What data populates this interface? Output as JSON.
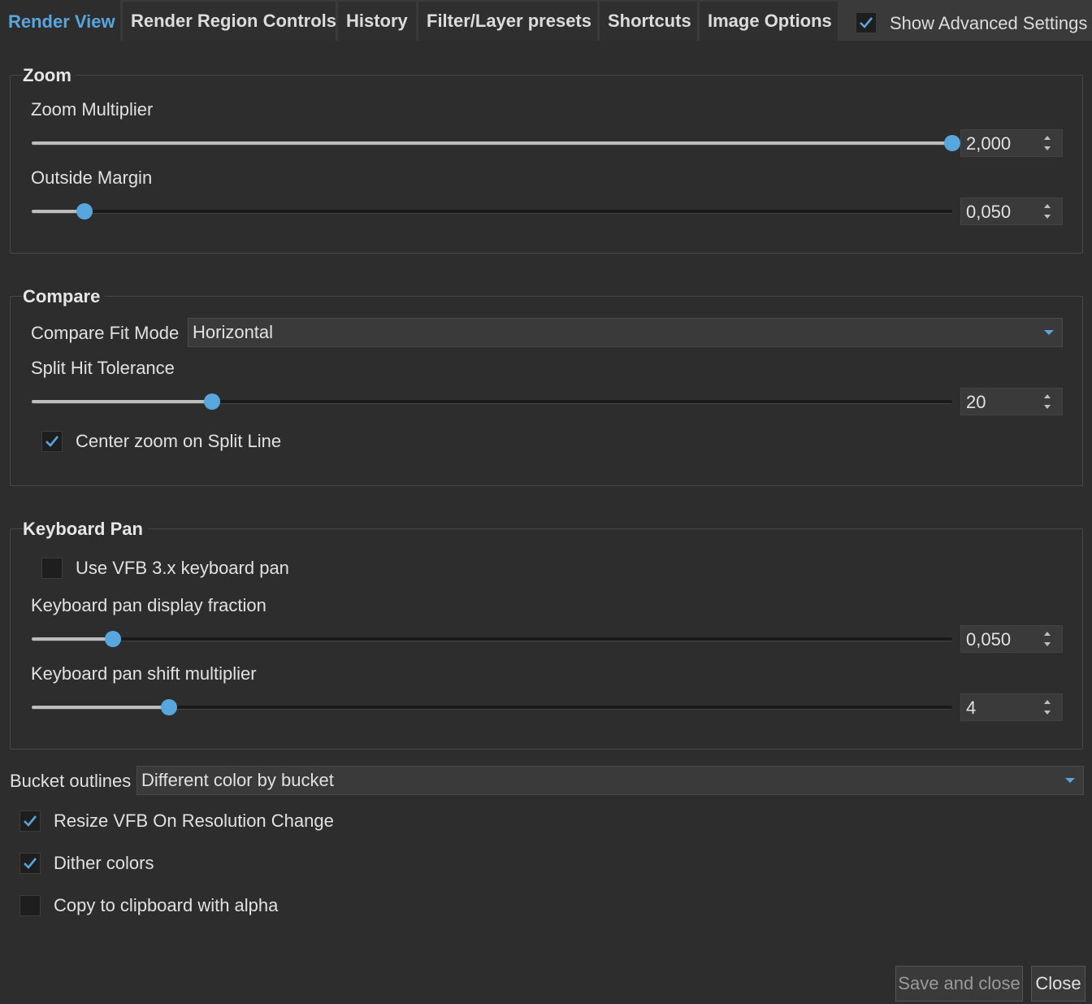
{
  "tabs": [
    {
      "label": "Render View",
      "active": true
    },
    {
      "label": "Render Region Controls"
    },
    {
      "label": "History"
    },
    {
      "label": "Filter/Layer presets"
    },
    {
      "label": "Shortcuts"
    },
    {
      "label": "Image Options"
    }
  ],
  "show_advanced": {
    "label": "Show Advanced Settings",
    "checked": true
  },
  "zoom": {
    "title": "Zoom",
    "multiplier": {
      "label": "Zoom Multiplier",
      "value": "2,000",
      "fraction": 1.0
    },
    "margin": {
      "label": "Outside Margin",
      "value": "0,050",
      "fraction": 0.057
    }
  },
  "compare": {
    "title": "Compare",
    "fit_mode_label": "Compare Fit Mode",
    "fit_mode_value": "Horizontal",
    "split": {
      "label": "Split Hit Tolerance",
      "value": "20",
      "fraction": 0.196
    },
    "center_zoom": {
      "label": "Center zoom on Split Line",
      "checked": true
    }
  },
  "keyboard_pan": {
    "title": "Keyboard Pan",
    "use_vfb3": {
      "label": "Use VFB 3.x keyboard pan",
      "checked": false
    },
    "fraction": {
      "label": "Keyboard pan display fraction",
      "value": "0,050",
      "fraction": 0.088
    },
    "shift": {
      "label": "Keyboard pan shift multiplier",
      "value": "4",
      "fraction": 0.149
    }
  },
  "bucket_outlines": {
    "label": "Bucket outlines",
    "value": "Different color by bucket"
  },
  "options": [
    {
      "label": "Resize VFB On Resolution Change",
      "checked": true
    },
    {
      "label": "Dither colors",
      "checked": true
    },
    {
      "label": "Copy to clipboard with alpha",
      "checked": false
    }
  ],
  "buttons": {
    "save_close": "Save and close",
    "close": "Close"
  },
  "colors": {
    "accent": "#58a6de",
    "background": "#2d2d2d",
    "tabbar": "#3a3a3a"
  }
}
